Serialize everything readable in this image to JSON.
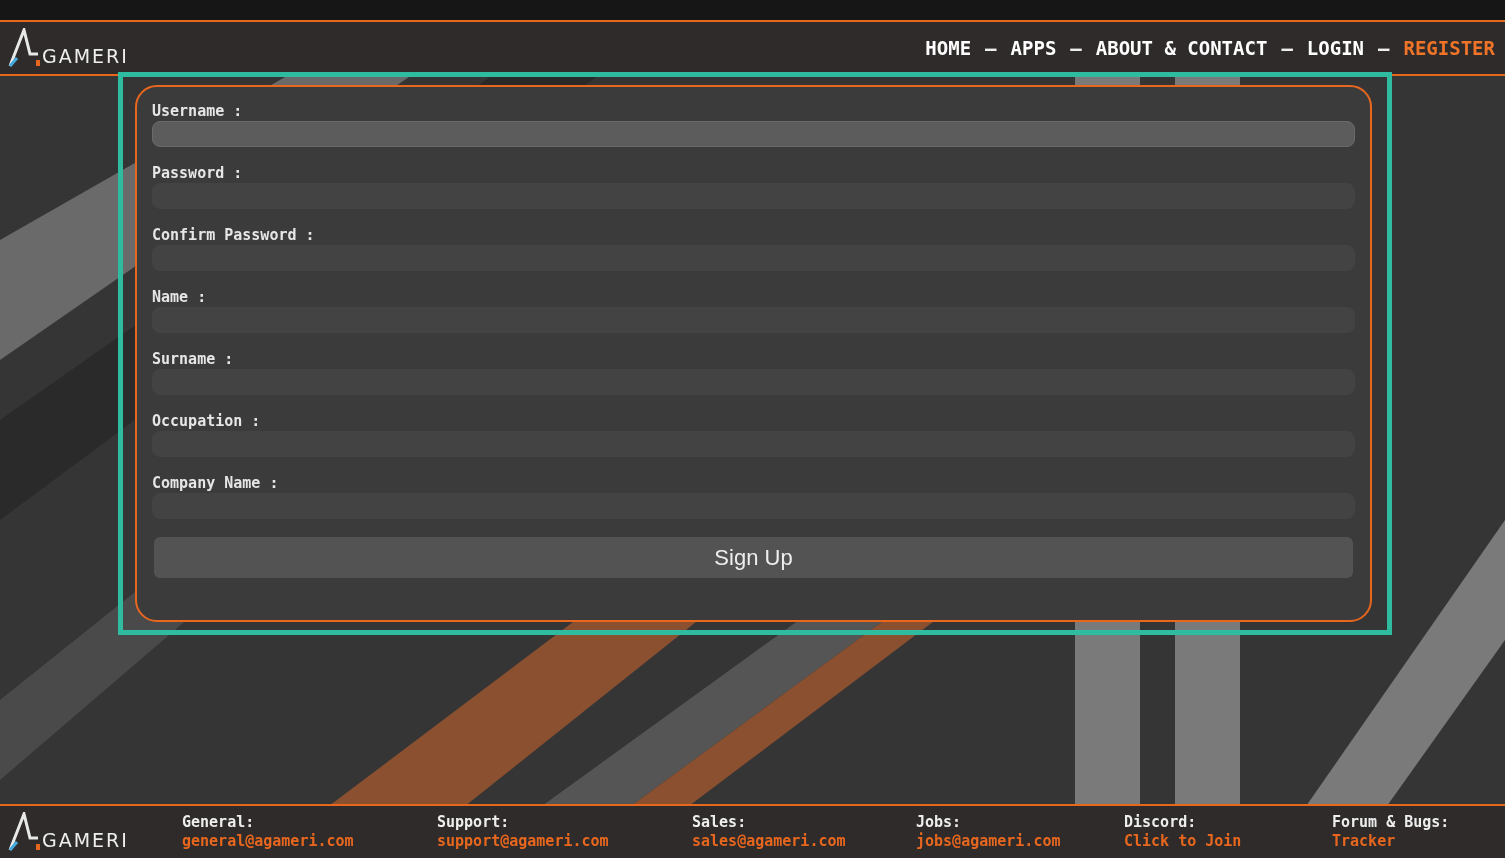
{
  "header": {
    "logo_text": "GAMERI",
    "nav": [
      {
        "label": "HOME",
        "selected": false
      },
      {
        "label": "APPS",
        "selected": false
      },
      {
        "label": "ABOUT & CONTACT",
        "selected": false
      },
      {
        "label": "LOGIN",
        "selected": false
      },
      {
        "label": "REGISTER",
        "selected": true
      }
    ],
    "separators": [
      "–",
      "–",
      "–",
      "–"
    ]
  },
  "form": {
    "fields": [
      {
        "label": "Username :",
        "focused": true
      },
      {
        "label": "Password :",
        "focused": false
      },
      {
        "label": "Confirm Password :",
        "focused": false
      },
      {
        "label": "Name :",
        "focused": false
      },
      {
        "label": "Surname :",
        "focused": false
      },
      {
        "label": "Occupation :",
        "focused": false
      },
      {
        "label": "Company Name :",
        "focused": false
      }
    ],
    "submit": "Sign Up"
  },
  "footer": {
    "logo_text": "GAMERI",
    "contacts": [
      {
        "label": "General:",
        "value": "general@agameri.com"
      },
      {
        "label": "Support:",
        "value": "support@agameri.com"
      },
      {
        "label": "Sales:",
        "value": "sales@agameri.com"
      },
      {
        "label": "Jobs:",
        "value": "jobs@agameri.com"
      },
      {
        "label": "Discord:",
        "value": "Click to Join"
      },
      {
        "label": "Forum & Bugs:",
        "value": "Tracker"
      }
    ]
  }
}
